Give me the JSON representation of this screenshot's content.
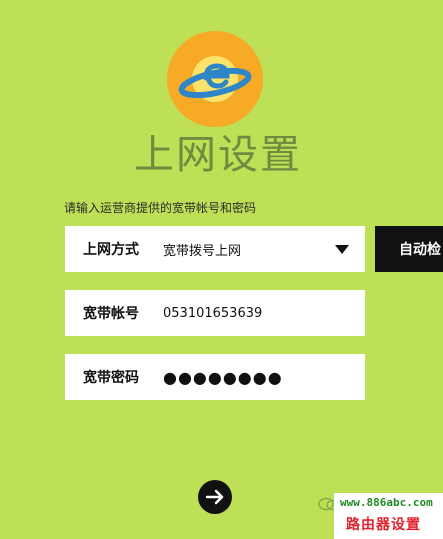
{
  "header": {
    "logo_icon": "ie-planet-logo",
    "title": "上网设置"
  },
  "form": {
    "instruction": "请输入运营商提供的宽带帐号和密码",
    "connection_type": {
      "label": "上网方式",
      "value": "宽带拨号上网"
    },
    "account": {
      "label": "宽带帐号",
      "value": "053101653639"
    },
    "password": {
      "label": "宽带密码",
      "masked_value": "●●●●●●●●"
    },
    "auto_detect_label": "自动检"
  },
  "footer": {
    "next_icon": "arrow-right-icon"
  },
  "watermark": {
    "url": "www.886abc.com",
    "text": "路由器设置"
  },
  "colors": {
    "background": "#bde057",
    "title": "#6f8b3f",
    "logo_orange": "#f7a71d",
    "logo_blue": "#2e86c8",
    "button_dark": "#111111",
    "watermark_green": "#1d8b22",
    "watermark_red": "#e0232e"
  }
}
